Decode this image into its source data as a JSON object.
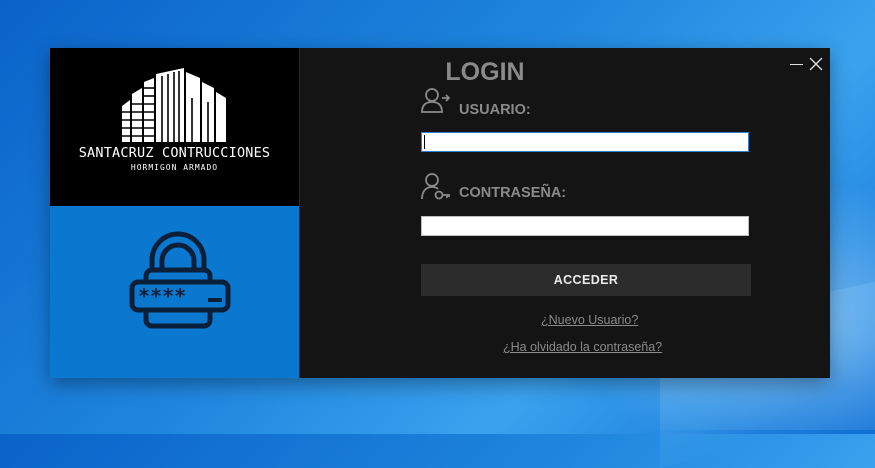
{
  "brand": {
    "title": "SANTACRUZ CONTRUCCIONES",
    "subtitle": "HORMIGON ARMADO",
    "logo_icon": "building-logo",
    "lock_icon": "password-lock-icon"
  },
  "window": {
    "title": "LOGIN",
    "minimize_icon": "minimize-icon",
    "close_icon": "close-icon"
  },
  "form": {
    "username": {
      "label": "USUARIO:",
      "value": "",
      "placeholder": "",
      "icon": "user-icon"
    },
    "password": {
      "label": "CONTRASEÑA:",
      "value": "",
      "placeholder": "",
      "icon": "user-key-icon"
    },
    "submit_label": "ACCEDER"
  },
  "links": {
    "new_user": "¿Nuevo Usuario?",
    "forgot_password": "¿Ha olvidado la contraseña?"
  },
  "colors": {
    "accent_blue": "#0b78d0",
    "window_bg": "#141414",
    "label_gray": "#8a8a8a",
    "button_bg": "#2c2c2c"
  }
}
